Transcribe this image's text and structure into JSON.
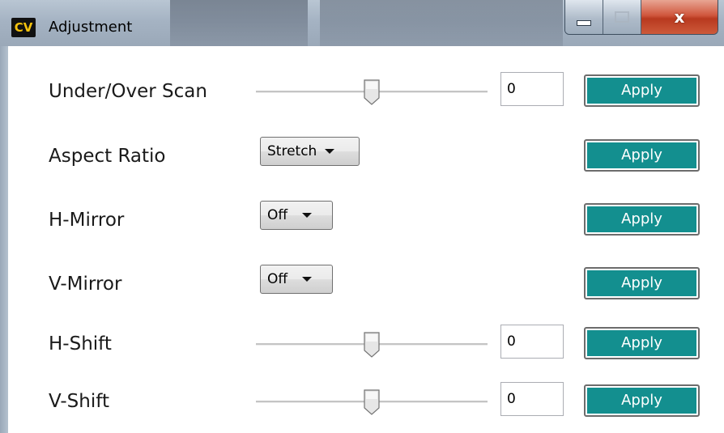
{
  "window": {
    "icon_text": "CV",
    "title": "Adjustment",
    "close_glyph": "x"
  },
  "rows": [
    {
      "label": "Under/Over Scan",
      "control": "slider",
      "slider_value": 0.5,
      "value": "0",
      "apply_label": "Apply"
    },
    {
      "label": "Aspect Ratio",
      "control": "dropdown",
      "selected": "Stretch",
      "apply_label": "Apply"
    },
    {
      "label": "H-Mirror",
      "control": "dropdown",
      "selected": "Off",
      "apply_label": "Apply"
    },
    {
      "label": "V-Mirror",
      "control": "dropdown",
      "selected": "Off",
      "apply_label": "Apply"
    },
    {
      "label": "H-Shift",
      "control": "slider",
      "slider_value": 0.5,
      "value": "0",
      "apply_label": "Apply"
    },
    {
      "label": "V-Shift",
      "control": "slider",
      "slider_value": 0.5,
      "value": "0",
      "apply_label": "Apply"
    }
  ],
  "colors": {
    "apply_fill": "#138f8f",
    "title_bar": "#a5b3c3",
    "close_button": "#c9462b"
  },
  "icons": {
    "app": "cv-logo-icon",
    "minimize": "minimize-icon",
    "maximize": "maximize-icon",
    "close": "close-icon",
    "dropdown": "chevron-down-icon"
  }
}
